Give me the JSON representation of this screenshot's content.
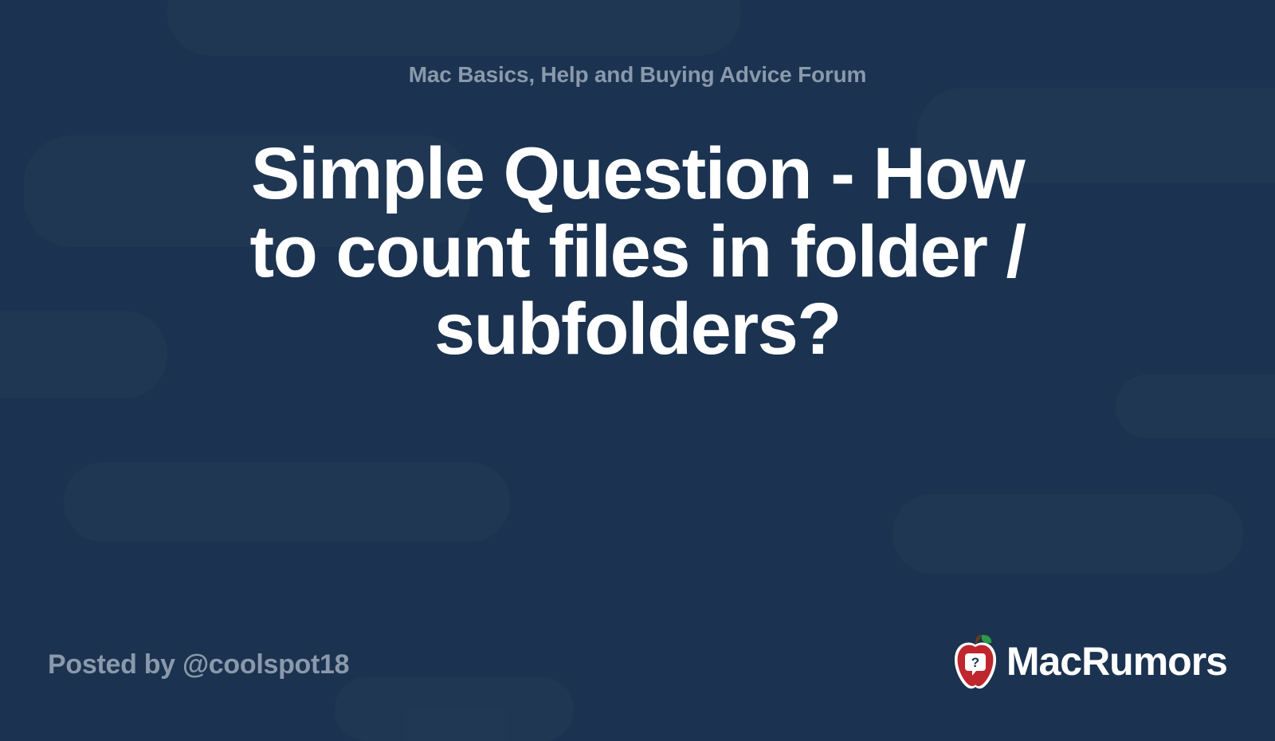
{
  "forum_name": "Mac Basics, Help and Buying Advice Forum",
  "title": "Simple Question - How to count files in folder / subfolders?",
  "posted_by_prefix": "Posted by ",
  "author_handle": "@coolspot18",
  "site_name": "MacRumors",
  "colors": {
    "background": "#1b3350",
    "muted_text": "#8a99ab",
    "title_text": "#ffffff",
    "logo_red": "#c0262d",
    "logo_green": "#2e9a47"
  }
}
